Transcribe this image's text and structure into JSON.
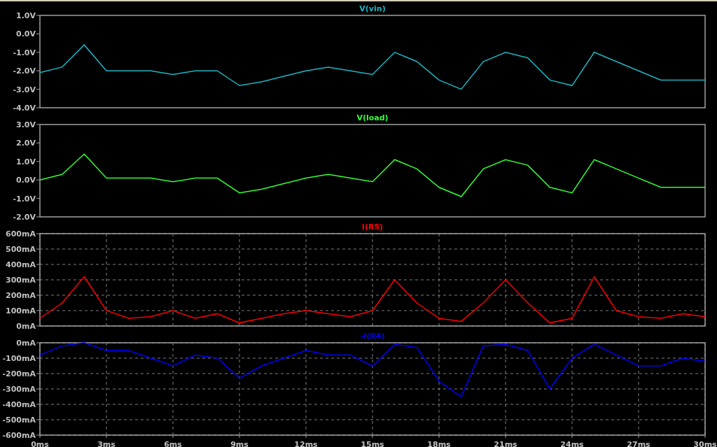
{
  "panes": [
    {
      "chart_data": {
        "type": "line",
        "title": "V(vin)",
        "grid": false,
        "xlim": [
          0,
          30
        ],
        "ylim": [
          -4,
          1
        ],
        "yticks": [
          {
            "value": 1,
            "label": "1.0V"
          },
          {
            "value": 0,
            "label": "0.0V"
          },
          {
            "value": -1,
            "label": "-1.0V"
          },
          {
            "value": -2,
            "label": "-2.0V"
          },
          {
            "value": -3,
            "label": "-3.0V"
          },
          {
            "value": -4,
            "label": "-4.0V"
          }
        ],
        "x": [
          0,
          1,
          2,
          3,
          4,
          5,
          6,
          7,
          8,
          9,
          10,
          11,
          12,
          13,
          14,
          15,
          16,
          17,
          18,
          19,
          20,
          21,
          22,
          23,
          24,
          25,
          26,
          27,
          28,
          29,
          30
        ],
        "series": [
          {
            "color": "#1fb5c4",
            "values": [
              -2.1,
              -1.8,
              -0.6,
              -2.0,
              -2.0,
              -2.0,
              -2.2,
              -2.0,
              -2.0,
              -2.8,
              -2.6,
              -2.3,
              -2.0,
              -1.8,
              -2.0,
              -2.2,
              -1.0,
              -1.5,
              -2.5,
              -3.0,
              -1.5,
              -1.0,
              -1.3,
              -2.5,
              -2.8,
              -1.0,
              -1.5,
              -2.0,
              -2.5,
              -2.5,
              -2.5
            ]
          }
        ]
      }
    },
    {
      "chart_data": {
        "type": "line",
        "title": "V(load)",
        "grid": false,
        "xlim": [
          0,
          30
        ],
        "ylim": [
          -2,
          3
        ],
        "yticks": [
          {
            "value": 3,
            "label": "3.0V"
          },
          {
            "value": 2,
            "label": "2.0V"
          },
          {
            "value": 1,
            "label": "1.0V"
          },
          {
            "value": 0,
            "label": "0.0V"
          },
          {
            "value": -1,
            "label": "-1.0V"
          },
          {
            "value": -2,
            "label": "-2.0V"
          }
        ],
        "x": [
          0,
          1,
          2,
          3,
          4,
          5,
          6,
          7,
          8,
          9,
          10,
          11,
          12,
          13,
          14,
          15,
          16,
          17,
          18,
          19,
          20,
          21,
          22,
          23,
          24,
          25,
          26,
          27,
          28,
          29,
          30
        ],
        "series": [
          {
            "color": "#33ff33",
            "values": [
              0.0,
              0.3,
              1.4,
              0.1,
              0.1,
              0.1,
              -0.1,
              0.1,
              0.1,
              -0.7,
              -0.5,
              -0.2,
              0.1,
              0.3,
              0.1,
              -0.1,
              1.1,
              0.6,
              -0.4,
              -0.9,
              0.6,
              1.1,
              0.8,
              -0.4,
              -0.7,
              1.1,
              0.6,
              0.1,
              -0.4,
              -0.4,
              -0.4
            ]
          }
        ]
      }
    },
    {
      "chart_data": {
        "type": "line",
        "title": "I(R5)",
        "grid": true,
        "xlim": [
          0,
          30
        ],
        "ylim": [
          0,
          600
        ],
        "yticks": [
          {
            "value": 600,
            "label": "600mA"
          },
          {
            "value": 500,
            "label": "500mA"
          },
          {
            "value": 400,
            "label": "400mA"
          },
          {
            "value": 300,
            "label": "300mA"
          },
          {
            "value": 200,
            "label": "200mA"
          },
          {
            "value": 100,
            "label": "100mA"
          },
          {
            "value": 0,
            "label": "0mA"
          }
        ],
        "x": [
          0,
          1,
          2,
          3,
          4,
          5,
          6,
          7,
          8,
          9,
          10,
          11,
          12,
          13,
          14,
          15,
          16,
          17,
          18,
          19,
          20,
          21,
          22,
          23,
          24,
          25,
          26,
          27,
          28,
          29,
          30
        ],
        "series": [
          {
            "color": "#ff0000",
            "values": [
              50,
              150,
              320,
              100,
              50,
              60,
              100,
              50,
              80,
              20,
              50,
              80,
              100,
              80,
              60,
              100,
              300,
              150,
              50,
              30,
              150,
              300,
              150,
              20,
              50,
              320,
              100,
              60,
              50,
              80,
              60
            ]
          }
        ]
      }
    },
    {
      "chart_data": {
        "type": "line",
        "title": "-I(R4)",
        "grid": true,
        "xlim": [
          0,
          30
        ],
        "ylim": [
          -600,
          0
        ],
        "xticks": [
          {
            "value": 0,
            "label": "0ms"
          },
          {
            "value": 3,
            "label": "3ms"
          },
          {
            "value": 6,
            "label": "6ms"
          },
          {
            "value": 9,
            "label": "9ms"
          },
          {
            "value": 12,
            "label": "12ms"
          },
          {
            "value": 15,
            "label": "15ms"
          },
          {
            "value": 18,
            "label": "18ms"
          },
          {
            "value": 21,
            "label": "21ms"
          },
          {
            "value": 24,
            "label": "24ms"
          },
          {
            "value": 27,
            "label": "27ms"
          },
          {
            "value": 30,
            "label": "30ms"
          }
        ],
        "yticks": [
          {
            "value": 0,
            "label": "0mA"
          },
          {
            "value": -100,
            "label": "-100mA"
          },
          {
            "value": -200,
            "label": "-200mA"
          },
          {
            "value": -300,
            "label": "-300mA"
          },
          {
            "value": -400,
            "label": "-400mA"
          },
          {
            "value": -500,
            "label": "-500mA"
          },
          {
            "value": -600,
            "label": "-600mA"
          }
        ],
        "x": [
          0,
          1,
          2,
          3,
          4,
          5,
          6,
          7,
          8,
          9,
          10,
          11,
          12,
          13,
          14,
          15,
          16,
          17,
          18,
          19,
          20,
          21,
          22,
          23,
          24,
          25,
          26,
          27,
          28,
          29,
          30
        ],
        "series": [
          {
            "color": "#0000ff",
            "values": [
              -80,
              -20,
              0,
              -50,
              -50,
              -100,
              -150,
              -80,
              -100,
              -230,
              -150,
              -100,
              -50,
              -80,
              -80,
              -150,
              -10,
              -30,
              -250,
              -350,
              -20,
              -10,
              -50,
              -300,
              -100,
              -10,
              -80,
              -150,
              -150,
              -100,
              -120
            ]
          }
        ]
      }
    }
  ]
}
